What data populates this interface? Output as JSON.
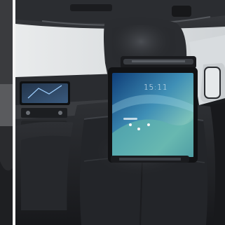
{
  "tablet": {
    "clock_text": "15:11"
  },
  "icons": {
    "headrest_mount": "tablet-holder-icon"
  }
}
